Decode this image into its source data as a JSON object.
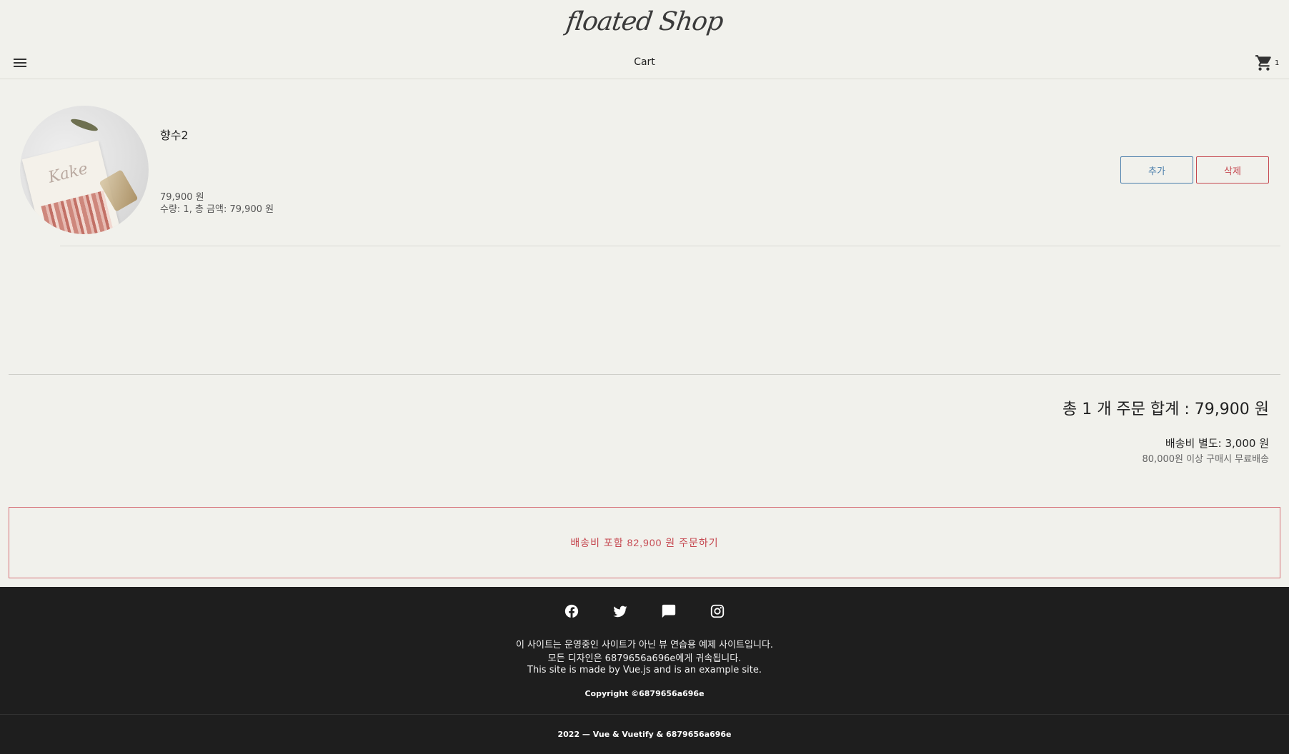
{
  "header": {
    "logo": "floated Shop",
    "title": "Cart",
    "cart_count": "1"
  },
  "item": {
    "name": "향수2",
    "price": "79,900 원",
    "detail": "수량: 1, 총 금액: 79,900 원",
    "add_label": "추가",
    "delete_label": "삭제"
  },
  "summary": {
    "total": "총 1 개 주문 합계 : 79,900 원",
    "shipping": "배송비 별도: 3,000 원",
    "free_shipping": "80,000원 이상 구매시 무료배송",
    "order_button": "배송비 포함 82,900 원 주문하기"
  },
  "footer": {
    "social_icons": [
      "facebook-icon",
      "twitter-icon",
      "message-icon",
      "instagram-icon"
    ],
    "line1": "이 사이트는 운영중인 사이트가 아닌 뷰 연습용 예제 사이트입니다.",
    "line2": "모든 디자인은 6879656a696e에게 귀속됩니다.",
    "line3": "This site is made by Vue.js and is an example site.",
    "copyright": "Copyright ©6879656a696e",
    "bottom": "2022 — Vue & Vuetify & 6879656a696e"
  },
  "colors": {
    "background": "#f1f1ec",
    "add_accent": "#4a7eab",
    "delete_accent": "#c5474f",
    "footer": "#1e1e1e"
  }
}
